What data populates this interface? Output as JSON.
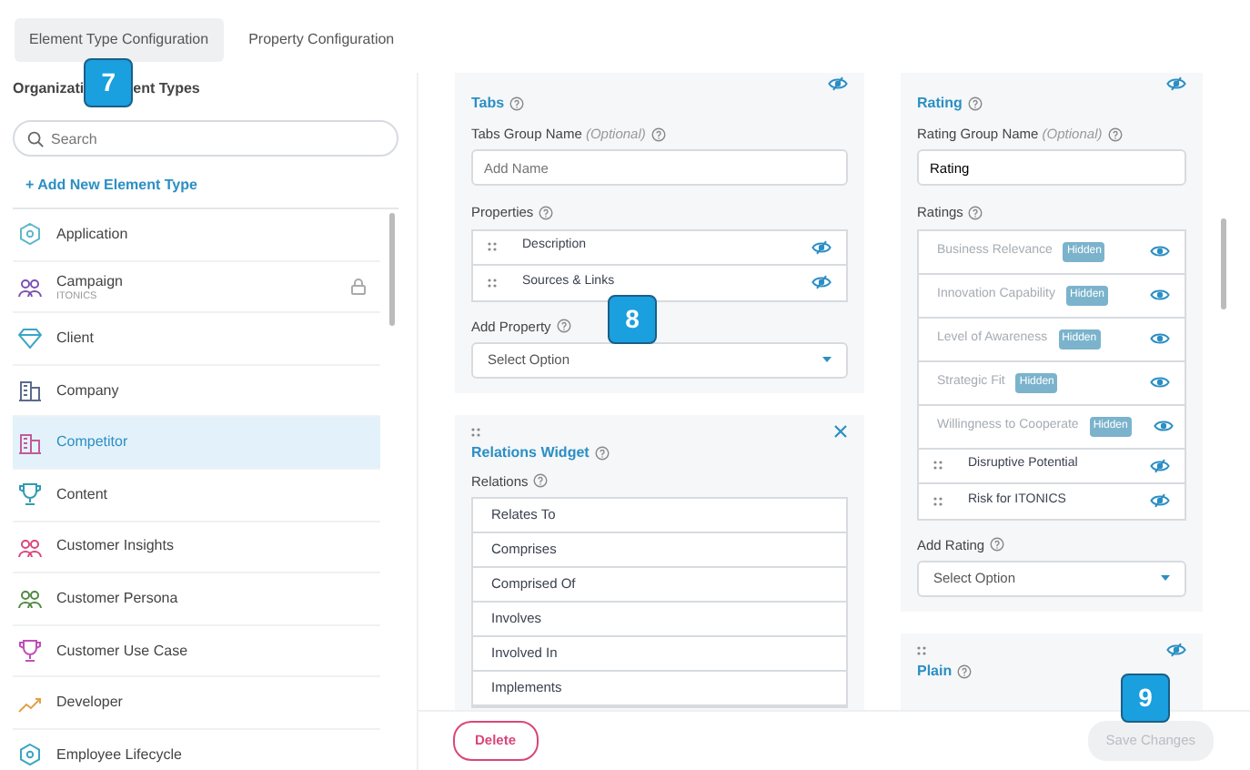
{
  "tabs": [
    {
      "label": "Element Type Configuration",
      "selected": true
    },
    {
      "label": "Property Configuration",
      "selected": false
    }
  ],
  "sidebar": {
    "title_parts": [
      "Organizati",
      "ent Types"
    ],
    "callout": "7",
    "search": {
      "placeholder": "Search"
    },
    "add_link": "+ Add New Element Type",
    "items": [
      {
        "label": "Application",
        "kind": "hexagon",
        "color": "#5fb8c9",
        "locked": false,
        "selected": false
      },
      {
        "label": "Campaign",
        "subtitle": "ITONICS",
        "kind": "people",
        "color": "#7b4fb0",
        "locked": true,
        "selected": false
      },
      {
        "label": "Client",
        "kind": "diamond",
        "color": "#3aa6c4",
        "locked": false,
        "selected": false
      },
      {
        "label": "Company",
        "kind": "building",
        "color": "#5a6b8c",
        "locked": false,
        "selected": false
      },
      {
        "label": "Competitor",
        "kind": "building",
        "color": "#c25a9a",
        "locked": false,
        "selected": true
      },
      {
        "label": "Content",
        "kind": "trophy",
        "color": "#2f9bb3",
        "locked": false,
        "selected": false
      },
      {
        "label": "Customer Insights",
        "kind": "people",
        "color": "#d9467a",
        "locked": false,
        "selected": false
      },
      {
        "label": "Customer Persona",
        "kind": "people",
        "color": "#4e8a3e",
        "locked": false,
        "selected": false
      },
      {
        "label": "Customer Use Case",
        "kind": "trophy",
        "color": "#c04fb8",
        "locked": false,
        "selected": false
      },
      {
        "label": "Developer",
        "kind": "trend",
        "color": "#e0a04a",
        "locked": false,
        "selected": false
      },
      {
        "label": "Employee Lifecycle",
        "kind": "hexagon",
        "color": "#3aa6c4",
        "locked": false,
        "selected": false
      }
    ]
  },
  "columns": [
    [
      {
        "kind": "group",
        "title": "Tabs",
        "group_label": "Tabs Group Name",
        "group_note": "(Optional)",
        "input": {
          "placeholder": "Add Name"
        },
        "list_label": "Properties",
        "items": [
          {
            "label": "Description",
            "hidden": false
          },
          {
            "label": "Sources & Links",
            "hidden": false
          }
        ],
        "add_label": "Add Property",
        "select": {
          "placeholder": "Select Option"
        }
      },
      {
        "kind": "relations",
        "title": "Relations Widget",
        "list_label": "Relations",
        "items": [
          {
            "label": "Relates To"
          },
          {
            "label": "Comprises"
          },
          {
            "label": "Comprised Of"
          },
          {
            "label": "Involves"
          },
          {
            "label": "Involved In"
          },
          {
            "label": "Implements"
          }
        ]
      }
    ],
    [
      {
        "kind": "group",
        "title": "Rating",
        "group_label": "Rating Group Name",
        "group_note": "(Optional)",
        "input": {
          "value": "Rating"
        },
        "list_label": "Ratings",
        "items": [
          {
            "label": "Business Relevance",
            "hidden": true,
            "badge": "Hidden"
          },
          {
            "label": "Innovation Capability",
            "hidden": true,
            "badge": "Hidden"
          },
          {
            "label": "Level of Awareness",
            "hidden": true,
            "badge": "Hidden"
          },
          {
            "label": "Strategic Fit",
            "hidden": true,
            "badge": "Hidden"
          },
          {
            "label": "Willingness to Cooperate",
            "hidden": true,
            "badge": "Hidden"
          },
          {
            "label": "Disruptive Potential",
            "hidden": false
          },
          {
            "label": "Risk for ITONICS",
            "hidden": false
          }
        ],
        "add_label": "Add Rating",
        "select": {
          "placeholder": "Select Option"
        }
      },
      {
        "kind": "title_only",
        "title": "Plain"
      }
    ]
  ],
  "callouts": [
    {
      "label": "8"
    },
    {
      "label": "9"
    }
  ],
  "footer": {
    "delete": "Delete",
    "save": {
      "label": "Save Changes",
      "disabled": true
    }
  }
}
